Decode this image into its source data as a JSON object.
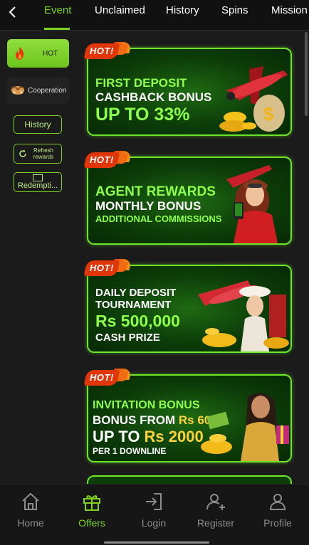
{
  "tabs": [
    {
      "label": "Event",
      "active": true
    },
    {
      "label": "Unclaimed",
      "active": false
    },
    {
      "label": "History",
      "active": false
    },
    {
      "label": "Spins",
      "active": false
    },
    {
      "label": "Mission",
      "active": false
    }
  ],
  "sidebar": {
    "hot_label": "HOT",
    "cooperation_label": "Cooperation",
    "history_label": "History",
    "refresh_label": "Refresh rewards",
    "redemption_label": "Redempti..."
  },
  "banners": [
    {
      "tag": "HOT!",
      "line1": "FIRST DEPOSIT",
      "line2": "CASHBACK BONUS",
      "line3": "UP TO 33%"
    },
    {
      "tag": "HOT!",
      "line1": "AGENT REWARDS",
      "line2": "MONTHLY BONUS",
      "line3": "ADDITIONAL COMMISSIONS"
    },
    {
      "tag": "HOT!",
      "line1": "DAILY DEPOSIT",
      "line2": "TOURNAMENT",
      "line3": "Rs 500,000",
      "line4": "CASH PRIZE"
    },
    {
      "tag": "HOT!",
      "line1": "INVITATION BONUS",
      "line2a": "BONUS FROM ",
      "line2b": "Rs 600",
      "line3a": "UP TO ",
      "line3b": "Rs 2000",
      "line4": "PER 1 DOWNLINE"
    }
  ],
  "bottom_nav": [
    {
      "label": "Home",
      "icon": "home-icon",
      "active": false
    },
    {
      "label": "Offers",
      "icon": "gift-icon",
      "active": true
    },
    {
      "label": "Login",
      "icon": "login-icon",
      "active": false
    },
    {
      "label": "Register",
      "icon": "add-user-icon",
      "active": false
    },
    {
      "label": "Profile",
      "icon": "user-icon",
      "active": false
    }
  ],
  "colors": {
    "accent": "#7ed321",
    "banner_border": "#6fe629",
    "hot_tag": "#e0360a"
  }
}
